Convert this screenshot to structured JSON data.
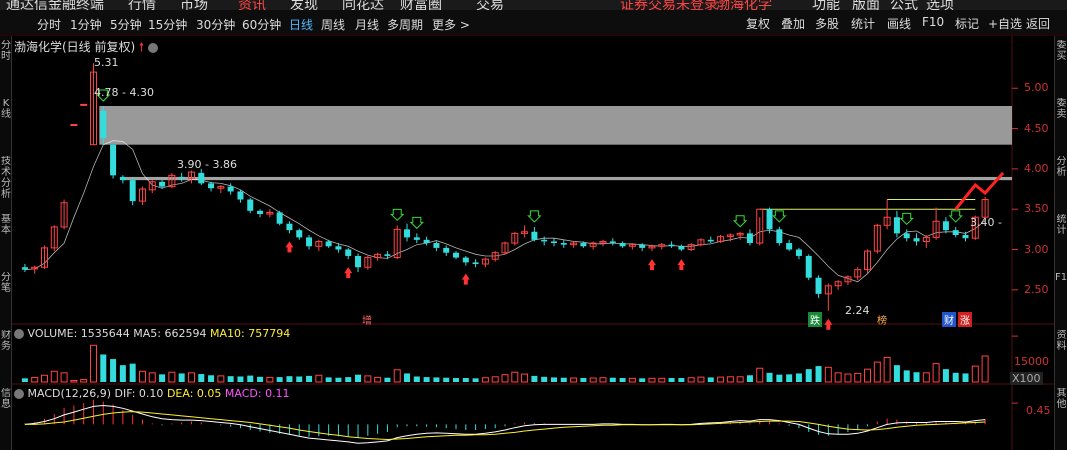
{
  "topnav": [
    "通达信金融终端",
    "行情",
    "市场",
    "资讯",
    "发现",
    "同花达",
    "财富圈",
    "交易",
    "证券交易未登录",
    "渤海化学",
    "功能",
    "版面",
    "公式",
    "选项"
  ],
  "periods": [
    "分时",
    "1分钟",
    "5分钟",
    "15分钟",
    "30分钟",
    "60分钟",
    "日线",
    "周线",
    "月线",
    "多周期",
    "更多 >"
  ],
  "active_period": "日线",
  "tools": [
    "复权",
    "叠加",
    "多股",
    "统计",
    "画线",
    "F10",
    "标记",
    "+自选",
    "返回"
  ],
  "stock_title": "渤海化学(日线 前复权)",
  "price_axis": [
    "5.00",
    "4.50",
    "4.00",
    "3.50",
    "3.00",
    "2.50"
  ],
  "annotations": {
    "high": "5.31",
    "band1": "4.78 - 4.30",
    "band2": "3.90 - 3.86",
    "low": "2.24",
    "current": "3.40 -"
  },
  "event_badges": {
    "zeng": "增",
    "die": "跌",
    "bang": "榜",
    "cai": "财",
    "zhang": "涨"
  },
  "volume": {
    "label": "VOLUME: 1535644",
    "ma5": "MA5: 662594",
    "ma10": "MA10: 757794",
    "axis": "15000",
    "unit": "X100"
  },
  "macd": {
    "label": "MACD(12,26,9)",
    "dif": "DIF: 0.10",
    "dea": "DEA: 0.05",
    "macd": "MACD: 0.11",
    "axis": "0.45"
  },
  "left_strip": [
    "分时",
    "K线",
    "技术分析",
    "基本",
    "分笔",
    "财务",
    "信息"
  ],
  "right_strip": [
    "委买",
    "委卖",
    "分析",
    "统计",
    "F10",
    "资料",
    "其他"
  ],
  "colors": {
    "up": "#ff4444",
    "down": "#33dddd",
    "ma5": "#ffffff",
    "ma10": "#ffee33",
    "gray_band": "#999999"
  },
  "chart_data": {
    "type": "candlestick",
    "price_ylim": [
      2.2,
      5.4
    ],
    "ohlc": [
      [
        2.78,
        2.82,
        2.72,
        2.75
      ],
      [
        2.76,
        2.8,
        2.7,
        2.78
      ],
      [
        2.78,
        3.05,
        2.76,
        3.02
      ],
      [
        3.02,
        3.3,
        2.98,
        3.28
      ],
      [
        3.28,
        3.62,
        3.25,
        3.58
      ],
      [
        4.55,
        4.55,
        4.55,
        4.55
      ],
      [
        4.8,
        4.8,
        4.8,
        4.8
      ],
      [
        4.3,
        5.31,
        4.3,
        5.2
      ],
      [
        4.72,
        4.78,
        4.3,
        4.38
      ],
      [
        4.3,
        4.3,
        3.88,
        3.92
      ],
      [
        3.9,
        3.92,
        3.82,
        3.86
      ],
      [
        3.86,
        3.9,
        3.55,
        3.6
      ],
      [
        3.6,
        3.78,
        3.55,
        3.75
      ],
      [
        3.74,
        3.86,
        3.7,
        3.84
      ],
      [
        3.84,
        3.86,
        3.75,
        3.78
      ],
      [
        3.78,
        3.95,
        3.76,
        3.92
      ],
      [
        3.9,
        3.95,
        3.84,
        3.88
      ],
      [
        3.88,
        3.98,
        3.82,
        3.96
      ],
      [
        3.95,
        4.0,
        3.8,
        3.82
      ],
      [
        3.82,
        3.84,
        3.72,
        3.76
      ],
      [
        3.76,
        3.8,
        3.7,
        3.78
      ],
      [
        3.78,
        3.82,
        3.68,
        3.72
      ],
      [
        3.72,
        3.74,
        3.58,
        3.62
      ],
      [
        3.62,
        3.64,
        3.45,
        3.48
      ],
      [
        3.48,
        3.5,
        3.4,
        3.44
      ],
      [
        3.44,
        3.5,
        3.4,
        3.46
      ],
      [
        3.46,
        3.48,
        3.3,
        3.32
      ],
      [
        3.32,
        3.35,
        3.2,
        3.24
      ],
      [
        3.24,
        3.26,
        3.12,
        3.15
      ],
      [
        3.15,
        3.18,
        3.0,
        3.04
      ],
      [
        3.04,
        3.12,
        2.98,
        3.1
      ],
      [
        3.1,
        3.12,
        3.02,
        3.04
      ],
      [
        3.04,
        3.08,
        2.96,
        3.0
      ],
      [
        3.0,
        3.02,
        2.88,
        2.92
      ],
      [
        2.92,
        2.95,
        2.72,
        2.78
      ],
      [
        2.78,
        2.92,
        2.75,
        2.9
      ],
      [
        2.9,
        2.96,
        2.86,
        2.94
      ],
      [
        2.94,
        2.98,
        2.88,
        2.92
      ],
      [
        2.9,
        3.3,
        2.88,
        3.25
      ],
      [
        3.25,
        3.32,
        3.1,
        3.15
      ],
      [
        3.15,
        3.2,
        3.08,
        3.12
      ],
      [
        3.12,
        3.16,
        3.05,
        3.08
      ],
      [
        3.08,
        3.1,
        2.98,
        3.02
      ],
      [
        3.02,
        3.05,
        2.92,
        2.96
      ],
      [
        2.96,
        2.98,
        2.88,
        2.9
      ],
      [
        2.9,
        2.92,
        2.8,
        2.84
      ],
      [
        2.84,
        2.88,
        2.78,
        2.82
      ],
      [
        2.82,
        2.9,
        2.78,
        2.88
      ],
      [
        2.88,
        2.98,
        2.85,
        2.96
      ],
      [
        2.96,
        3.1,
        2.94,
        3.08
      ],
      [
        3.08,
        3.22,
        3.05,
        3.2
      ],
      [
        3.2,
        3.3,
        3.15,
        3.22
      ],
      [
        3.22,
        3.28,
        3.1,
        3.12
      ],
      [
        3.12,
        3.16,
        3.05,
        3.1
      ],
      [
        3.1,
        3.14,
        3.04,
        3.08
      ],
      [
        3.08,
        3.12,
        3.02,
        3.06
      ],
      [
        3.06,
        3.1,
        3.02,
        3.08
      ],
      [
        3.08,
        3.1,
        3.02,
        3.04
      ],
      [
        3.04,
        3.1,
        3.0,
        3.08
      ],
      [
        3.08,
        3.12,
        3.04,
        3.1
      ],
      [
        3.1,
        3.14,
        3.05,
        3.08
      ],
      [
        3.08,
        3.1,
        3.02,
        3.04
      ],
      [
        3.04,
        3.08,
        3.0,
        3.06
      ],
      [
        3.06,
        3.08,
        2.98,
        3.02
      ],
      [
        3.02,
        3.06,
        2.98,
        3.04
      ],
      [
        3.04,
        3.08,
        3.0,
        3.06
      ],
      [
        3.06,
        3.1,
        3.02,
        3.04
      ],
      [
        3.04,
        3.06,
        2.98,
        3.0
      ],
      [
        3.0,
        3.08,
        2.98,
        3.06
      ],
      [
        3.06,
        3.14,
        3.04,
        3.12
      ],
      [
        3.12,
        3.16,
        3.08,
        3.1
      ],
      [
        3.1,
        3.18,
        3.08,
        3.16
      ],
      [
        3.16,
        3.2,
        3.1,
        3.18
      ],
      [
        3.18,
        3.22,
        3.12,
        3.2
      ],
      [
        3.2,
        3.25,
        3.05,
        3.08
      ],
      [
        3.08,
        3.4,
        3.05,
        3.5
      ],
      [
        3.5,
        3.52,
        3.2,
        3.25
      ],
      [
        3.25,
        3.28,
        3.05,
        3.08
      ],
      [
        3.08,
        3.12,
        2.98,
        3.0
      ],
      [
        3.0,
        3.02,
        2.88,
        2.92
      ],
      [
        2.92,
        2.94,
        2.62,
        2.65
      ],
      [
        2.65,
        2.68,
        2.4,
        2.45
      ],
      [
        2.45,
        2.58,
        2.24,
        2.55
      ],
      [
        2.55,
        2.62,
        2.5,
        2.6
      ],
      [
        2.6,
        2.68,
        2.56,
        2.66
      ],
      [
        2.66,
        2.78,
        2.62,
        2.75
      ],
      [
        2.75,
        3.0,
        2.7,
        2.98
      ],
      [
        2.98,
        3.32,
        2.95,
        3.3
      ],
      [
        3.3,
        3.62,
        3.25,
        3.4
      ],
      [
        3.4,
        3.48,
        3.15,
        3.2
      ],
      [
        3.2,
        3.25,
        3.1,
        3.14
      ],
      [
        3.14,
        3.2,
        3.05,
        3.1
      ],
      [
        3.1,
        3.18,
        3.02,
        3.15
      ],
      [
        3.15,
        3.52,
        3.12,
        3.35
      ],
      [
        3.35,
        3.4,
        3.2,
        3.24
      ],
      [
        3.24,
        3.28,
        3.15,
        3.18
      ],
      [
        3.18,
        3.22,
        3.1,
        3.14
      ],
      [
        3.14,
        3.42,
        3.12,
        3.4
      ],
      [
        3.4,
        3.65,
        3.38,
        3.62
      ]
    ],
    "ma5": [
      2.75,
      2.76,
      2.83,
      2.96,
      3.08,
      3.4,
      3.7,
      4.03,
      4.3,
      4.35,
      4.34,
      4.24,
      3.94,
      3.8,
      3.76,
      3.8,
      3.82,
      3.87,
      3.86,
      3.83,
      3.82,
      3.79,
      3.74,
      3.66,
      3.6,
      3.54,
      3.46,
      3.39,
      3.32,
      3.24,
      3.17,
      3.11,
      3.07,
      3.04,
      2.98,
      2.93,
      2.9,
      2.89,
      2.95,
      3.0,
      3.06,
      3.08,
      3.11,
      3.07,
      3.02,
      2.98,
      2.94,
      2.92,
      2.92,
      2.94,
      3.0,
      3.07,
      3.12,
      3.14,
      3.14,
      3.12,
      3.1,
      3.09,
      3.07,
      3.07,
      3.08,
      3.07,
      3.07,
      3.06,
      3.05,
      3.04,
      3.05,
      3.04,
      3.04,
      3.06,
      3.07,
      3.1,
      3.12,
      3.15,
      3.14,
      3.22,
      3.24,
      3.22,
      3.18,
      3.15,
      3.04,
      2.92,
      2.79,
      2.68,
      2.64,
      2.6,
      2.7,
      2.84,
      3.0,
      3.13,
      3.22,
      3.23,
      3.16,
      3.21,
      3.22,
      3.22,
      3.2,
      3.26,
      3.36
    ],
    "volume_ylim": [
      0,
      17000
    ],
    "volume": [
      1200,
      1500,
      2200,
      3500,
      3000,
      500,
      800,
      12000,
      9000,
      7500,
      5500,
      6000,
      3500,
      3000,
      2500,
      3200,
      2800,
      3000,
      2600,
      2200,
      2000,
      1900,
      1800,
      2100,
      1700,
      1500,
      1600,
      1900,
      1800,
      2000,
      2200,
      1500,
      1400,
      1600,
      2400,
      2000,
      1500,
      1400,
      4000,
      2800,
      1800,
      1600,
      1500,
      1400,
      1300,
      1300,
      1200,
      1400,
      1700,
      2400,
      3200,
      2600,
      2000,
      1700,
      1500,
      1400,
      1300,
      1300,
      1300,
      1400,
      1400,
      1300,
      1200,
      1200,
      1200,
      1200,
      1300,
      1300,
      1400,
      1600,
      1500,
      1600,
      1700,
      1700,
      2200,
      4500,
      3000,
      2400,
      2500,
      2800,
      4200,
      5200,
      4800,
      3000,
      2600,
      2800,
      4200,
      6500,
      8000,
      5500,
      3800,
      3200,
      3000,
      6000,
      4200,
      3000,
      2800,
      5200,
      8500
    ],
    "macd_ylim": [
      -0.5,
      0.6
    ],
    "macd_hist": [
      0.02,
      0.05,
      0.12,
      0.22,
      0.35,
      0.4,
      0.45,
      0.52,
      0.48,
      0.42,
      0.3,
      0.2,
      0.1,
      0.02,
      -0.02,
      0.02,
      0.04,
      0.06,
      0.04,
      0.0,
      -0.02,
      -0.05,
      -0.08,
      -0.12,
      -0.15,
      -0.18,
      -0.2,
      -0.22,
      -0.24,
      -0.26,
      -0.25,
      -0.24,
      -0.25,
      -0.26,
      -0.28,
      -0.24,
      -0.2,
      -0.16,
      -0.06,
      -0.04,
      -0.04,
      -0.05,
      -0.06,
      -0.08,
      -0.1,
      -0.12,
      -0.12,
      -0.1,
      -0.08,
      -0.04,
      0.02,
      0.04,
      0.03,
      0.02,
      0.01,
      0.0,
      0.0,
      0.0,
      0.0,
      0.01,
      0.01,
      0.0,
      0.0,
      -0.01,
      -0.01,
      0.0,
      0.0,
      -0.01,
      0.0,
      0.02,
      0.02,
      0.03,
      0.04,
      0.05,
      0.02,
      0.08,
      0.06,
      0.02,
      -0.03,
      -0.08,
      -0.16,
      -0.22,
      -0.24,
      -0.2,
      -0.16,
      -0.12,
      -0.04,
      0.06,
      0.12,
      0.1,
      0.06,
      0.04,
      0.03,
      0.06,
      0.04,
      0.03,
      0.02,
      0.06,
      0.11
    ],
    "dif": [
      0.0,
      0.02,
      0.06,
      0.12,
      0.2,
      0.26,
      0.32,
      0.38,
      0.4,
      0.38,
      0.34,
      0.28,
      0.22,
      0.16,
      0.12,
      0.1,
      0.09,
      0.09,
      0.08,
      0.06,
      0.04,
      0.02,
      -0.01,
      -0.05,
      -0.09,
      -0.13,
      -0.17,
      -0.21,
      -0.25,
      -0.29,
      -0.31,
      -0.33,
      -0.35,
      -0.37,
      -0.4,
      -0.39,
      -0.37,
      -0.35,
      -0.28,
      -0.24,
      -0.21,
      -0.19,
      -0.18,
      -0.19,
      -0.2,
      -0.21,
      -0.21,
      -0.19,
      -0.16,
      -0.12,
      -0.07,
      -0.03,
      -0.01,
      0.0,
      0.0,
      0.0,
      0.0,
      0.0,
      0.0,
      0.01,
      0.01,
      0.0,
      0.0,
      -0.01,
      -0.01,
      0.0,
      0.0,
      -0.01,
      0.0,
      0.02,
      0.03,
      0.04,
      0.06,
      0.08,
      0.07,
      0.1,
      0.1,
      0.08,
      0.04,
      0.0,
      -0.08,
      -0.15,
      -0.2,
      -0.21,
      -0.21,
      -0.19,
      -0.14,
      -0.07,
      0.0,
      0.03,
      0.04,
      0.04,
      0.04,
      0.06,
      0.06,
      0.06,
      0.05,
      0.08,
      0.1
    ],
    "dea": [
      0.0,
      0.0,
      0.01,
      0.03,
      0.05,
      0.09,
      0.13,
      0.17,
      0.21,
      0.24,
      0.26,
      0.27,
      0.26,
      0.24,
      0.22,
      0.2,
      0.18,
      0.16,
      0.14,
      0.12,
      0.1,
      0.08,
      0.06,
      0.04,
      0.01,
      -0.02,
      -0.05,
      -0.08,
      -0.12,
      -0.15,
      -0.18,
      -0.21,
      -0.23,
      -0.26,
      -0.28,
      -0.3,
      -0.31,
      -0.32,
      -0.31,
      -0.3,
      -0.28,
      -0.26,
      -0.25,
      -0.24,
      -0.23,
      -0.23,
      -0.22,
      -0.22,
      -0.21,
      -0.19,
      -0.17,
      -0.14,
      -0.12,
      -0.1,
      -0.08,
      -0.06,
      -0.05,
      -0.04,
      -0.03,
      -0.02,
      -0.02,
      -0.01,
      -0.01,
      -0.01,
      -0.01,
      -0.01,
      -0.01,
      -0.01,
      -0.01,
      0.0,
      0.01,
      0.02,
      0.03,
      0.04,
      0.05,
      0.06,
      0.07,
      0.07,
      0.07,
      0.06,
      0.03,
      0.0,
      -0.04,
      -0.07,
      -0.1,
      -0.11,
      -0.12,
      -0.11,
      -0.09,
      -0.06,
      -0.04,
      -0.02,
      -0.01,
      0.0,
      0.01,
      0.02,
      0.03,
      0.04,
      0.05
    ]
  }
}
